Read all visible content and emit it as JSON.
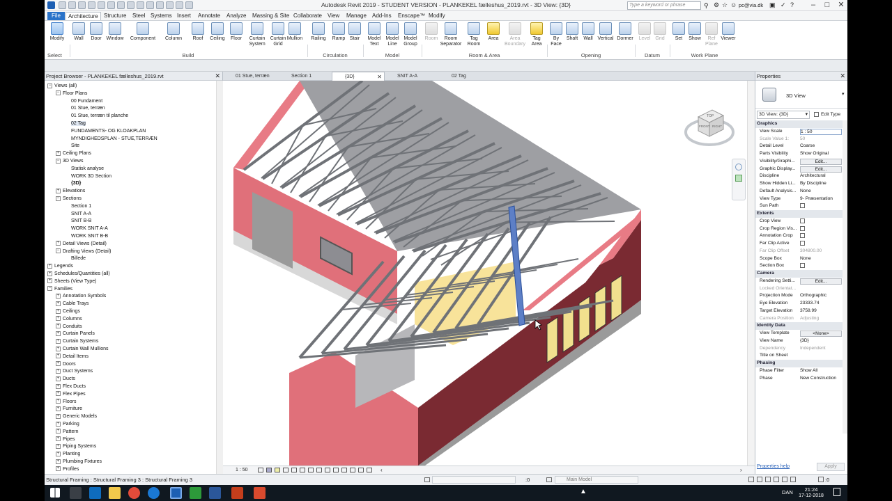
{
  "titlebar": {
    "title": "Autodesk Revit 2019 - STUDENT VERSION - PLANKEKEL fælleshus_2019.rvt - 3D View: {3D}",
    "search_placeholder": "Type a keyword or phrase",
    "user": "pc@via.dk"
  },
  "menu": [
    "File",
    "Architecture",
    "Structure",
    "Steel",
    "Systems",
    "Insert",
    "Annotate",
    "Analyze",
    "Massing & Site",
    "Collaborate",
    "View",
    "Manage",
    "Add-Ins",
    "Enscape™",
    "Modify"
  ],
  "ribbon": {
    "select_label": "Select",
    "buttons": [
      "Modify",
      "Wall",
      "Door",
      "Window",
      "Component",
      "Column",
      "Roof",
      "Ceiling",
      "Floor",
      "Curtain System",
      "Curtain Grid",
      "Mullion",
      "Railing",
      "Ramp",
      "Stair",
      "Model Text",
      "Model Line",
      "Model Group",
      "Room",
      "Room Separator",
      "Tag Room",
      "Area",
      "Area Boundary",
      "Tag Area",
      "By Face",
      "Shaft",
      "Wall",
      "Vertical",
      "Dormer",
      "Level",
      "Grid",
      "Set",
      "Show",
      "Ref Plane",
      "Viewer"
    ],
    "panels": [
      "Build",
      "Circulation",
      "Model",
      "Room & Area",
      "Opening",
      "Datum",
      "Work Plane"
    ]
  },
  "project_browser": {
    "title": "Project Browser - PLANKEKEL fælleshus_2019.rvt",
    "items": [
      "Views (all)",
      "Floor Plans",
      "00 Fundament",
      "01 Stue, terræn",
      "01 Stue, terræn til planche",
      "02 Tag",
      "FUNDAMENTS- OG KLOAKPLAN",
      "MYNDIGHEDSPLAN - STUE,TERRÆN",
      "Site",
      "Ceiling Plans",
      "3D Views",
      "Statisk analyse",
      "WORK 3D Section",
      "{3D}",
      "Elevations",
      "Sections",
      "Section 1",
      "SNIT A-A",
      "SNIT B-B",
      "WORK SNIT A-A",
      "WORK SNIT B-B",
      "Detail Views (Detail)",
      "Drafting Views (Detail)",
      "Billede",
      "Legends",
      "Schedules/Quantities (all)",
      "Sheets (View Type)",
      "Families",
      "Annotation Symbols",
      "Cable Trays",
      "Ceilings",
      "Columns",
      "Conduits",
      "Curtain Panels",
      "Curtain Systems",
      "Curtain Wall Mullions",
      "Detail Items",
      "Doors",
      "Duct Systems",
      "Ducts",
      "Flex Ducts",
      "Flex Pipes",
      "Floors",
      "Furniture",
      "Generic Models",
      "Parking",
      "Pattern",
      "Pipes",
      "Piping Systems",
      "Planting",
      "Plumbing Fixtures",
      "Profiles"
    ]
  },
  "view_tabs": [
    "01 Stue, terræn",
    "Section 1",
    "{3D}",
    "SNIT A-A",
    "02 Tag"
  ],
  "view_control": {
    "scale": "1 : 50"
  },
  "viewcube": {
    "top": "TOP",
    "front": "FRONT",
    "right": "RIGHT"
  },
  "properties": {
    "title": "Properties",
    "type_name": "3D View",
    "selector": "3D View: {3D}",
    "edit_type": "Edit Type",
    "groups": {
      "graphics": "Graphics",
      "extents": "Extents",
      "camera": "Camera",
      "identity": "Identity Data",
      "phasing": "Phasing"
    },
    "rows": {
      "view_scale": [
        "View Scale",
        "1 : 50"
      ],
      "scale_value": [
        "Scale Value  1:",
        "50"
      ],
      "detail_level": [
        "Detail Level",
        "Coarse"
      ],
      "parts_visibility": [
        "Parts Visibility",
        "Show Original"
      ],
      "vis_graphics": [
        "Visibility/Graphi...",
        "Edit..."
      ],
      "graphic_display": [
        "Graphic Display...",
        "Edit..."
      ],
      "discipline": [
        "Discipline",
        "Architectural"
      ],
      "show_hidden": [
        "Show Hidden Li...",
        "By Discipline"
      ],
      "default_analysis": [
        "Default Analysis...",
        "None"
      ],
      "view_type": [
        "View Type",
        "9- Præsentation"
      ],
      "sun_path": [
        "Sun Path",
        ""
      ],
      "crop_view": [
        "Crop View",
        ""
      ],
      "crop_region": [
        "Crop Region Vis...",
        ""
      ],
      "annotation_crop": [
        "Annotation Crop",
        ""
      ],
      "far_clip_active": [
        "Far Clip Active",
        ""
      ],
      "far_clip_offset": [
        "Far Clip Offset",
        "304800.00"
      ],
      "scope_box": [
        "Scope Box",
        "None"
      ],
      "section_box": [
        "Section Box",
        ""
      ],
      "rendering": [
        "Rendering Setti...",
        "Edit..."
      ],
      "locked_orient": [
        "Locked Orientat...",
        ""
      ],
      "projection": [
        "Projection Mode",
        "Orthographic"
      ],
      "eye_elevation": [
        "Eye Elevation",
        "23333.74"
      ],
      "target_elevation": [
        "Target Elevation",
        "3758.99"
      ],
      "camera_position": [
        "Camera Position",
        "Adjusting"
      ],
      "view_template": [
        "View Template",
        "<None>"
      ],
      "view_name": [
        "View Name",
        "{3D}"
      ],
      "dependency": [
        "Dependency",
        "Independent"
      ],
      "title_on_sheet": [
        "Title on Sheet",
        ""
      ],
      "phase_filter": [
        "Phase Filter",
        "Show All"
      ],
      "phase": [
        "Phase",
        "New Construction"
      ]
    },
    "help": "Properties help",
    "apply": "Apply"
  },
  "status": {
    "text": "Structural Framing : Structural Framing 3 : Structural Framing 3",
    "count": ":0",
    "workset": "Main Model",
    "filter": ":0"
  },
  "taskbar": {
    "time": "21:24",
    "date": "17-12-2018",
    "lang": "DAN"
  },
  "colors": {
    "accent": "#2a73c9",
    "wall_pink": "#e0707a",
    "wall_dark": "#7a2a32",
    "truss": "#8a8d92"
  }
}
